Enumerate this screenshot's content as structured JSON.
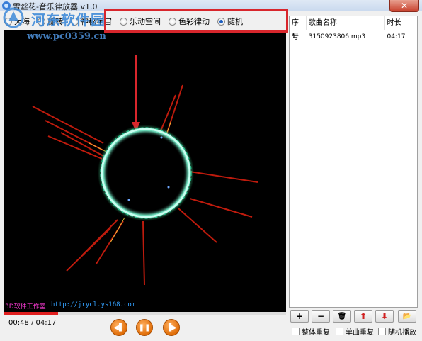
{
  "window": {
    "title": "雪丝花-音乐律放器 v1.0",
    "close_label": "✕"
  },
  "watermark": {
    "line1": "河东软件园",
    "line2": "www.pc0359.cn"
  },
  "modes": [
    {
      "label": "大海",
      "checked": false
    },
    {
      "label": "旋转",
      "checked": false
    },
    {
      "label": "神秘宇宙",
      "checked": false
    },
    {
      "label": "乐动空间",
      "checked": false
    },
    {
      "label": "色彩律动",
      "checked": false
    },
    {
      "label": "随机",
      "checked": true
    }
  ],
  "visualizer": {
    "studio_label": "3D软件工作室",
    "studio_url": "http://jrycl.ys168.com",
    "progress": 0.19
  },
  "player": {
    "time": "00:48 / 04:17",
    "prev_icon": "prev-icon",
    "pause_icon": "pause-icon",
    "next_icon": "next-icon"
  },
  "playlist": {
    "headers": {
      "index": "序号",
      "name": "歌曲名称",
      "duration": "时长"
    },
    "rows": [
      {
        "index": "1",
        "name": "3150923806.mp3",
        "duration": "04:17"
      }
    ],
    "buttons": [
      {
        "name": "add",
        "icon": "plus-icon",
        "glyph": "+"
      },
      {
        "name": "remove",
        "icon": "minus-icon",
        "glyph": "−"
      },
      {
        "name": "delete",
        "icon": "trash-icon",
        "glyph": "🗑"
      },
      {
        "name": "move-up",
        "icon": "arrow-up-icon",
        "glyph": "⬆"
      },
      {
        "name": "move-down",
        "icon": "arrow-down-icon",
        "glyph": "⬇"
      },
      {
        "name": "open",
        "icon": "folder-open-icon",
        "glyph": "📂"
      }
    ],
    "options": {
      "repeat_all": "整体重复",
      "repeat_one": "单曲重复",
      "shuffle": "随机播放"
    }
  },
  "colors": {
    "accent": "#e06d08",
    "highlight": "#d8262c",
    "ring": "#7dffd8"
  }
}
